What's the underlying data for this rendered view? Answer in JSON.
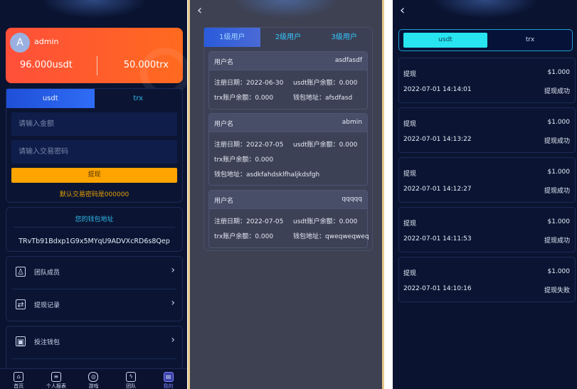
{
  "wallet_page": {
    "avatar_letter": "A",
    "username": "admin",
    "usdt_balance": "96.000usdt",
    "trx_balance": "50.000trx",
    "tabs": [
      "usdt",
      "trx"
    ],
    "amount_placeholder": "请输入金额",
    "password_placeholder": "请输入交易密码",
    "withdraw_button": "提现",
    "default_password_note": "默认交易密码是000000",
    "wallet_address_title": "您的钱包地址",
    "wallet_address": "TRvTb91Bdxp1G9x5MYqU9ADVXcRD6s8Qep",
    "menu": [
      {
        "label": "团队成员",
        "icon": "team-icon"
      },
      {
        "label": "提现记录",
        "icon": "record-icon"
      },
      {
        "label": "投注钱包",
        "icon": "wallet-icon"
      }
    ],
    "tabbar": [
      {
        "label": "首页",
        "icon": "home-icon"
      },
      {
        "label": "个人报表",
        "icon": "report-icon"
      },
      {
        "label": "游戏",
        "icon": "gamepad-icon"
      },
      {
        "label": "团队",
        "icon": "lightning-icon"
      },
      {
        "label": "我的",
        "icon": "profile-icon"
      }
    ]
  },
  "team_page": {
    "tabs": [
      "1级用户",
      "2级用户",
      "3级用户"
    ],
    "users": [
      {
        "username_label": "用户名",
        "username": "asdfasdf",
        "reg_date": "注册日期：2022-06-30",
        "usdt_balance": "usdt账户余额：0.000",
        "trx_balance": "trx账户余额：0.000",
        "wallet": "钱包地址：afsdfasd"
      },
      {
        "username_label": "用户名",
        "username": "abmin",
        "reg_date": "注册日期：2022-07-05",
        "usdt_balance": "usdt账户余额：0.000",
        "trx_balance": "trx账户余额：0.000",
        "wallet": "钱包地址：asdkfahdsklfhaljkdsfgh"
      },
      {
        "username_label": "用户名",
        "username": "qqqqq",
        "reg_date": "注册日期：2022-07-05",
        "usdt_balance": "usdt账户余额：0.000",
        "trx_balance": "trx账户余额：0.000",
        "wallet": "钱包地址：qweqweqweq"
      }
    ]
  },
  "records_page": {
    "tabs": [
      "usdt",
      "trx"
    ],
    "records": [
      {
        "type": "提现",
        "amount": "$1.000",
        "time": "2022-07-01 14:14:01",
        "status": "提现成功"
      },
      {
        "type": "提现",
        "amount": "$1.000",
        "time": "2022-07-01 14:13:22",
        "status": "提现成功"
      },
      {
        "type": "提现",
        "amount": "$1.000",
        "time": "2022-07-01 14:12:27",
        "status": "提现成功"
      },
      {
        "type": "提现",
        "amount": "$1.000",
        "time": "2022-07-01 14:11:53",
        "status": "提现成功"
      },
      {
        "type": "提现",
        "amount": "$1.000",
        "time": "2022-07-01 14:10:16",
        "status": "提现失败"
      }
    ]
  },
  "colors": {
    "accent_orange": "#ff5a2e",
    "button_yellow": "#ffa400",
    "tab_cyan": "#27e4f0",
    "bg_navy": "#0a1330"
  }
}
